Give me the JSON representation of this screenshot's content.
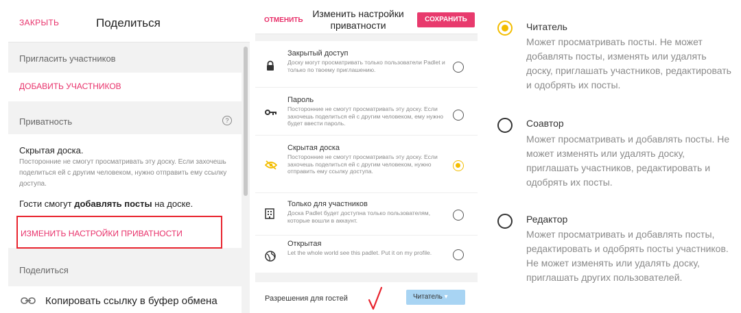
{
  "share_panel": {
    "close_label": "ЗАКРЫТЬ",
    "title": "Поделиться",
    "invite_heading": "Пригласить участников",
    "add_members_label": "ДОБАВИТЬ УЧАСТНИКОВ",
    "privacy_heading": "Приватность",
    "help_icon_glyph": "?",
    "current_privacy_title": "Скрытая доска.",
    "current_privacy_desc": "Посторонние не смогут просматривать эту доску. Если захочешь поделиться ей с другим человеком, нужно отправить ему ссылку доступа.",
    "guests_prefix": "Гости смогут ",
    "guests_bold": "добавлять посты",
    "guests_suffix": " на доске.",
    "change_privacy_label": "ИЗМЕНИТЬ НАСТРОЙКИ ПРИВАТНОСТИ",
    "share_heading": "Поделиться",
    "copy_link_label": "Копировать ссылку в буфер обмена",
    "highlight_color": "#e8232d",
    "accent_color": "#e8306a"
  },
  "privacy_panel": {
    "cancel_label": "ОТМЕНИТЬ",
    "title": "Изменить настройки приватности",
    "save_label": "СОХРАНИТЬ",
    "options": [
      {
        "icon": "lock-icon",
        "title": "Закрытый доступ",
        "desc": "Доску могут просматривать только пользователи Padlet и только по твоему приглашению.",
        "selected": false
      },
      {
        "icon": "key-icon",
        "title": "Пароль",
        "desc": "Посторонние не смогут просматривать эту доску. Если захочешь поделиться ей с другим человеком, ему нужно будет ввести пароль.",
        "selected": false
      },
      {
        "icon": "eye-off-icon",
        "title": "Скрытая доска",
        "desc": "Посторонние не смогут просматривать эту доску. Если захочешь поделиться ей с другим человеком, нужно отправить ему ссылку доступа.",
        "selected": true
      },
      {
        "icon": "building-icon",
        "title": "Только для участников",
        "desc": "Доска Padlet будет доступна только пользователям, которые вошли в аккаунт.",
        "selected": false
      },
      {
        "icon": "globe-icon",
        "title": "Открытая",
        "desc": "Let the whole world see this padlet. Put it on my profile.",
        "selected": false
      }
    ],
    "guest_permissions_label": "Разрешения для гостей",
    "guest_permissions_value": "Читатель",
    "dropdown_arrow": "▾",
    "selected_color": "#f3bd00",
    "save_color": "#e83a6d",
    "select_color": "#a8d4f3"
  },
  "permissions_panel": {
    "options": [
      {
        "title": "Читатель",
        "desc": "Может просматривать посты. Не может добавлять посты, изменять или удалять доску, приглашать участников, редактировать и одобрять их посты.",
        "selected": true
      },
      {
        "title": "Соавтор",
        "desc": "Может просматривать и добавлять посты. Не может изменять или удалять доску, приглашать участников, редактировать и одобрять их посты.",
        "selected": false
      },
      {
        "title": "Редактор",
        "desc": "Может просматривать и добавлять посты, редактировать и одобрять посты участников. Не может изменять или удалять доску, приглашать других пользователей.",
        "selected": false
      }
    ]
  }
}
